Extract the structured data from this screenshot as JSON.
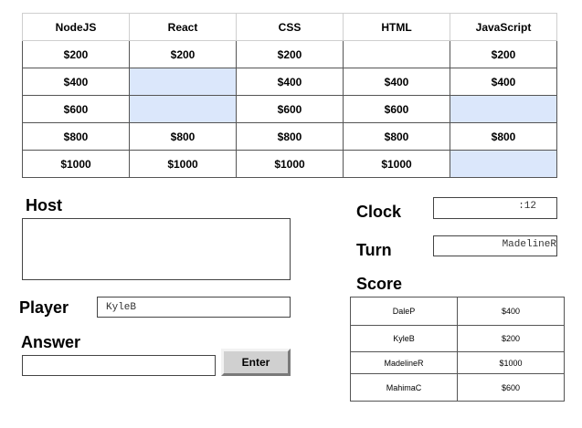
{
  "board": {
    "categories": [
      "NodeJS",
      "React",
      "CSS",
      "HTML",
      "JavaScript"
    ],
    "rows": [
      [
        "$200",
        "$200",
        "$200",
        "",
        "$200"
      ],
      [
        "$400",
        "",
        "$400",
        "$400",
        "$400"
      ],
      [
        "$600",
        "",
        "$600",
        "$600",
        ""
      ],
      [
        "$800",
        "$800",
        "$800",
        "$800",
        "$800"
      ],
      [
        "$1000",
        "$1000",
        "$1000",
        "$1000",
        ""
      ]
    ],
    "used_color": "#dbe7fb"
  },
  "host": {
    "label": "Host",
    "text": ""
  },
  "player": {
    "label": "Player",
    "value": "KyleB"
  },
  "answer": {
    "label": "Answer",
    "value": "",
    "button_label": "Enter"
  },
  "clock": {
    "label": "Clock",
    "value": ":12"
  },
  "turn": {
    "label": "Turn",
    "value": "MadelineR"
  },
  "score": {
    "label": "Score",
    "rows": [
      {
        "name": "DaleP",
        "points": "$400"
      },
      {
        "name": "KyleB",
        "points": "$200"
      },
      {
        "name": "MadelineR",
        "points": "$1000"
      },
      {
        "name": "MahimaC",
        "points": "$600"
      }
    ]
  }
}
